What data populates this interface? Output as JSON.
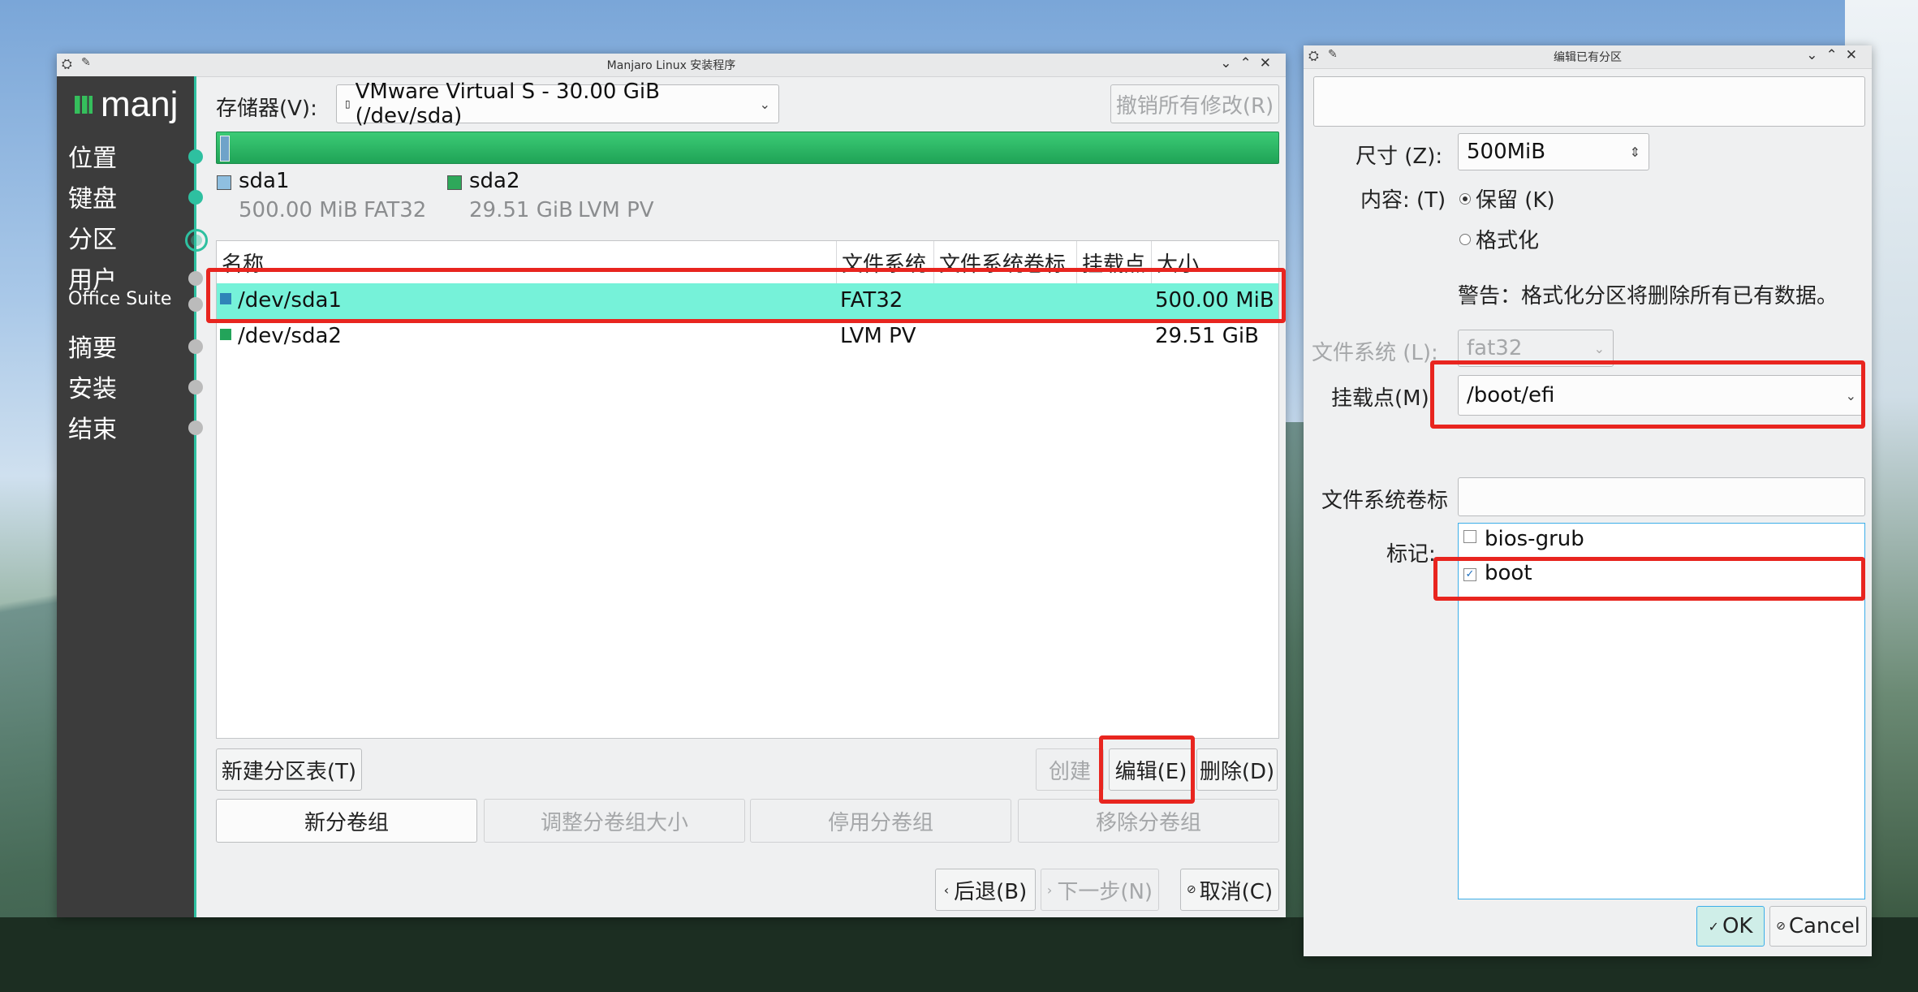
{
  "main_window": {
    "title": "Manjaro Linux 安装程序",
    "logo_text": "manj",
    "steps": [
      {
        "label": "位置",
        "state": "done"
      },
      {
        "label": "键盘",
        "state": "done"
      },
      {
        "label": "分区",
        "state": "current"
      },
      {
        "label": "用户",
        "state": "todo"
      },
      {
        "label": "Office Suite",
        "state": "todo"
      },
      {
        "label": "摘要",
        "state": "todo"
      },
      {
        "label": "安装",
        "state": "todo"
      },
      {
        "label": "结束",
        "state": "todo"
      }
    ],
    "storage_label": "存储器(V):",
    "storage_value": "VMware Virtual S - 30.00 GiB (/dev/sda)",
    "revert_button": "撤销所有修改(R)",
    "legend": [
      {
        "name": "sda1",
        "size": "500.00 MiB",
        "fs": "FAT32",
        "color": "#8fbfe0"
      },
      {
        "name": "sda2",
        "size": "29.51 GiB",
        "fs": "LVM PV",
        "color": "#2ea85a"
      }
    ],
    "table": {
      "columns": [
        "名称",
        "文件系统",
        "文件系统卷标",
        "挂载点",
        "大小"
      ],
      "rows": [
        {
          "name": "/dev/sda1",
          "fs": "FAT32",
          "label": "",
          "mount": "",
          "size": "500.00 MiB",
          "color": "#2f84b8",
          "selected": true
        },
        {
          "name": "/dev/sda2",
          "fs": "LVM PV",
          "label": "",
          "mount": "",
          "size": "29.51 GiB",
          "color": "#23a45a",
          "selected": false
        }
      ]
    },
    "buttons": {
      "new_table": "新建分区表(T)",
      "create": "创建",
      "edit": "编辑(E)",
      "delete": "删除(D)",
      "new_vg": "新分卷组",
      "resize_vg": "调整分卷组大小",
      "deactivate_vg": "停用分卷组",
      "remove_vg": "移除分卷组",
      "back": "后退(B)",
      "next": "下一步(N)",
      "cancel": "取消(C)"
    }
  },
  "dialog": {
    "title": "编辑已有分区",
    "size_label": "尺寸 (Z):",
    "size_value": "500MiB",
    "content_label": "内容: (T)",
    "keep_label": "保留 (K)",
    "format_label": "格式化",
    "warning": "警告：格式化分区将删除所有已有数据。",
    "fs_label": "文件系统 (L):",
    "fs_value": "fat32",
    "mount_label": "挂载点(M):",
    "mount_value": "/boot/efi",
    "fslabel_label": "文件系统卷标",
    "fslabel_value": "",
    "flags_label": "标记:",
    "flags": [
      {
        "name": "bios-grub",
        "checked": false
      },
      {
        "name": "boot",
        "checked": true
      }
    ],
    "ok": "OK",
    "cancel": "Cancel"
  }
}
